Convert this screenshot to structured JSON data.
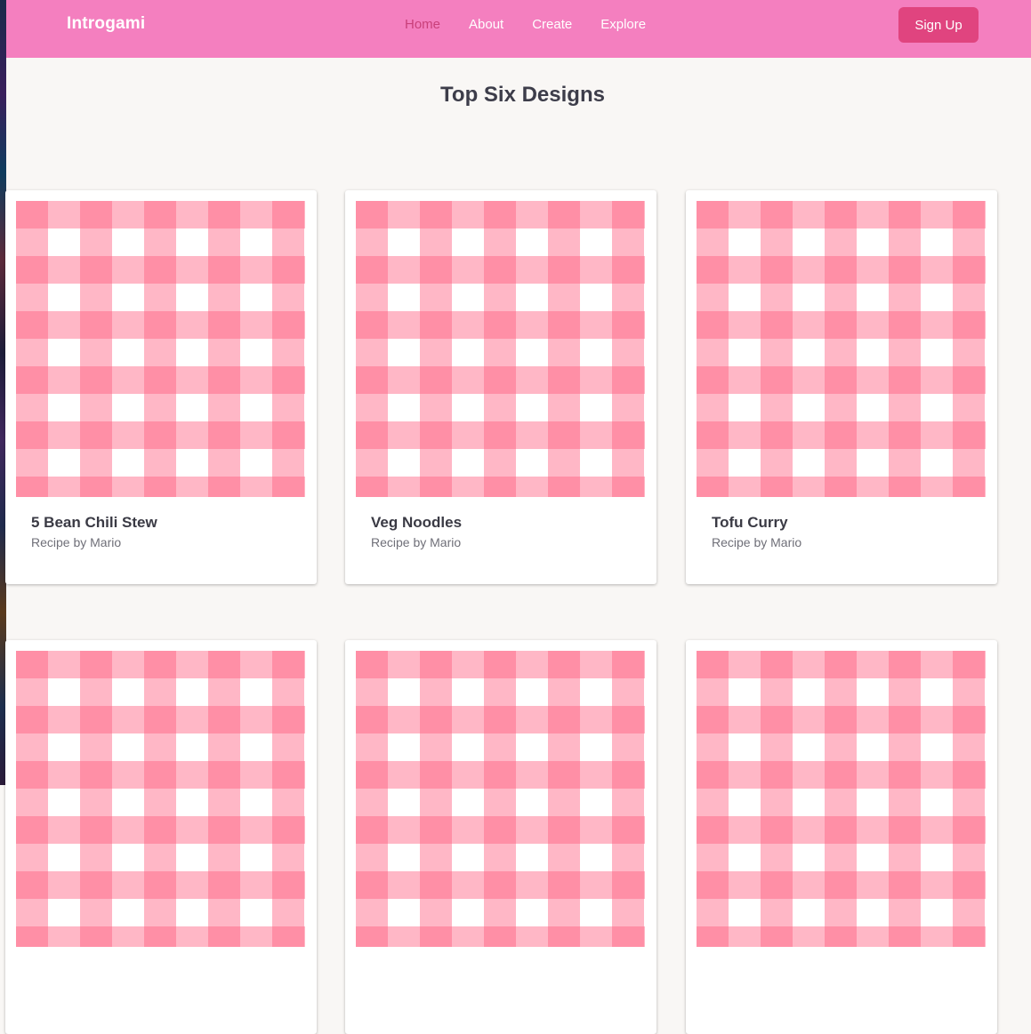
{
  "navbar": {
    "brand": "Introgami",
    "links": [
      {
        "label": "Home",
        "active": true
      },
      {
        "label": "About",
        "active": false
      },
      {
        "label": "Create",
        "active": false
      },
      {
        "label": "Explore",
        "active": false
      }
    ],
    "signup_label": "Sign Up"
  },
  "main": {
    "title": "Top Six Designs",
    "cards": [
      {
        "title": "5 Bean Chili Stew",
        "subtitle": "Recipe by Mario"
      },
      {
        "title": "Veg Noodles",
        "subtitle": "Recipe by Mario"
      },
      {
        "title": "Tofu Curry",
        "subtitle": "Recipe by Mario"
      },
      {
        "title": "",
        "subtitle": ""
      },
      {
        "title": "",
        "subtitle": ""
      },
      {
        "title": "",
        "subtitle": ""
      }
    ]
  },
  "colors": {
    "navbar_bg": "#f47fbf",
    "signup_bg": "#e0447f",
    "active_link": "#c9407a",
    "page_bg": "#f9f7f5",
    "gingham": "#ff5f80"
  }
}
